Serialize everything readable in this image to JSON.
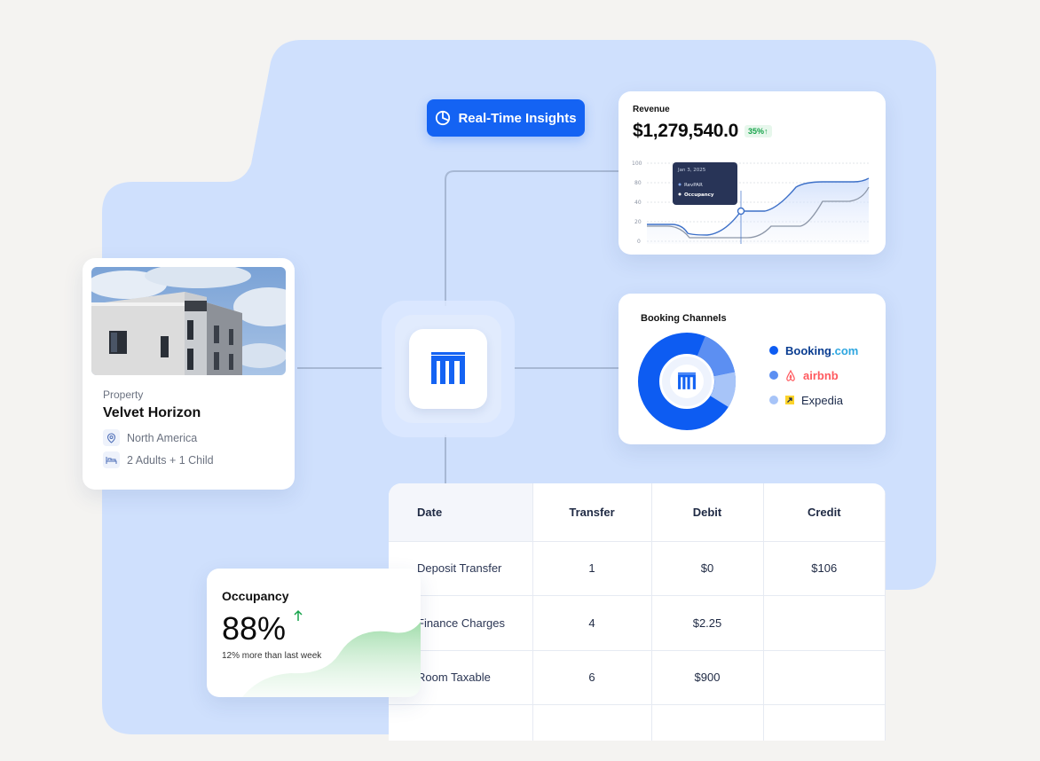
{
  "insights": {
    "label": "Real-Time Insights",
    "icon": "pie-chart-icon"
  },
  "revenue": {
    "title": "Revenue",
    "value": "$1,279,540.0",
    "change": "35%↑",
    "tooltip": {
      "date": "Jan 3, 2025",
      "series": [
        "RevPAR",
        "Occupancy"
      ]
    },
    "axis_ticks": [
      "100",
      "80",
      "40",
      "20",
      "0"
    ]
  },
  "booking": {
    "title": "Booking Channels",
    "channels": [
      {
        "name_part1": "Booking",
        "name_part2": ".com",
        "color": "#0d5cf2"
      },
      {
        "name": "airbnb",
        "color": "#5c8ff2"
      },
      {
        "name": "Expedia",
        "color": "#a7c4f8"
      }
    ]
  },
  "property": {
    "label": "Property",
    "name": "Velvet Horizon",
    "location": "North America",
    "guests": "2 Adults + 1 Child"
  },
  "table": {
    "headers": [
      "Date",
      "Transfer",
      "Debit",
      "Credit"
    ],
    "rows": [
      [
        "Deposit Transfer",
        "1",
        "$0",
        "$106"
      ],
      [
        "Finance Charges",
        "4",
        "$2.25",
        ""
      ],
      [
        "Room Taxable",
        "6",
        "$900",
        ""
      ],
      [
        "",
        "",
        "",
        ""
      ]
    ]
  },
  "occupancy": {
    "title": "Occupancy",
    "value": "88%",
    "note": "12% more than last week"
  },
  "colors": {
    "accent": "#1463f3",
    "background_panel": "#cfe0fd",
    "positive": "#16a34a"
  }
}
